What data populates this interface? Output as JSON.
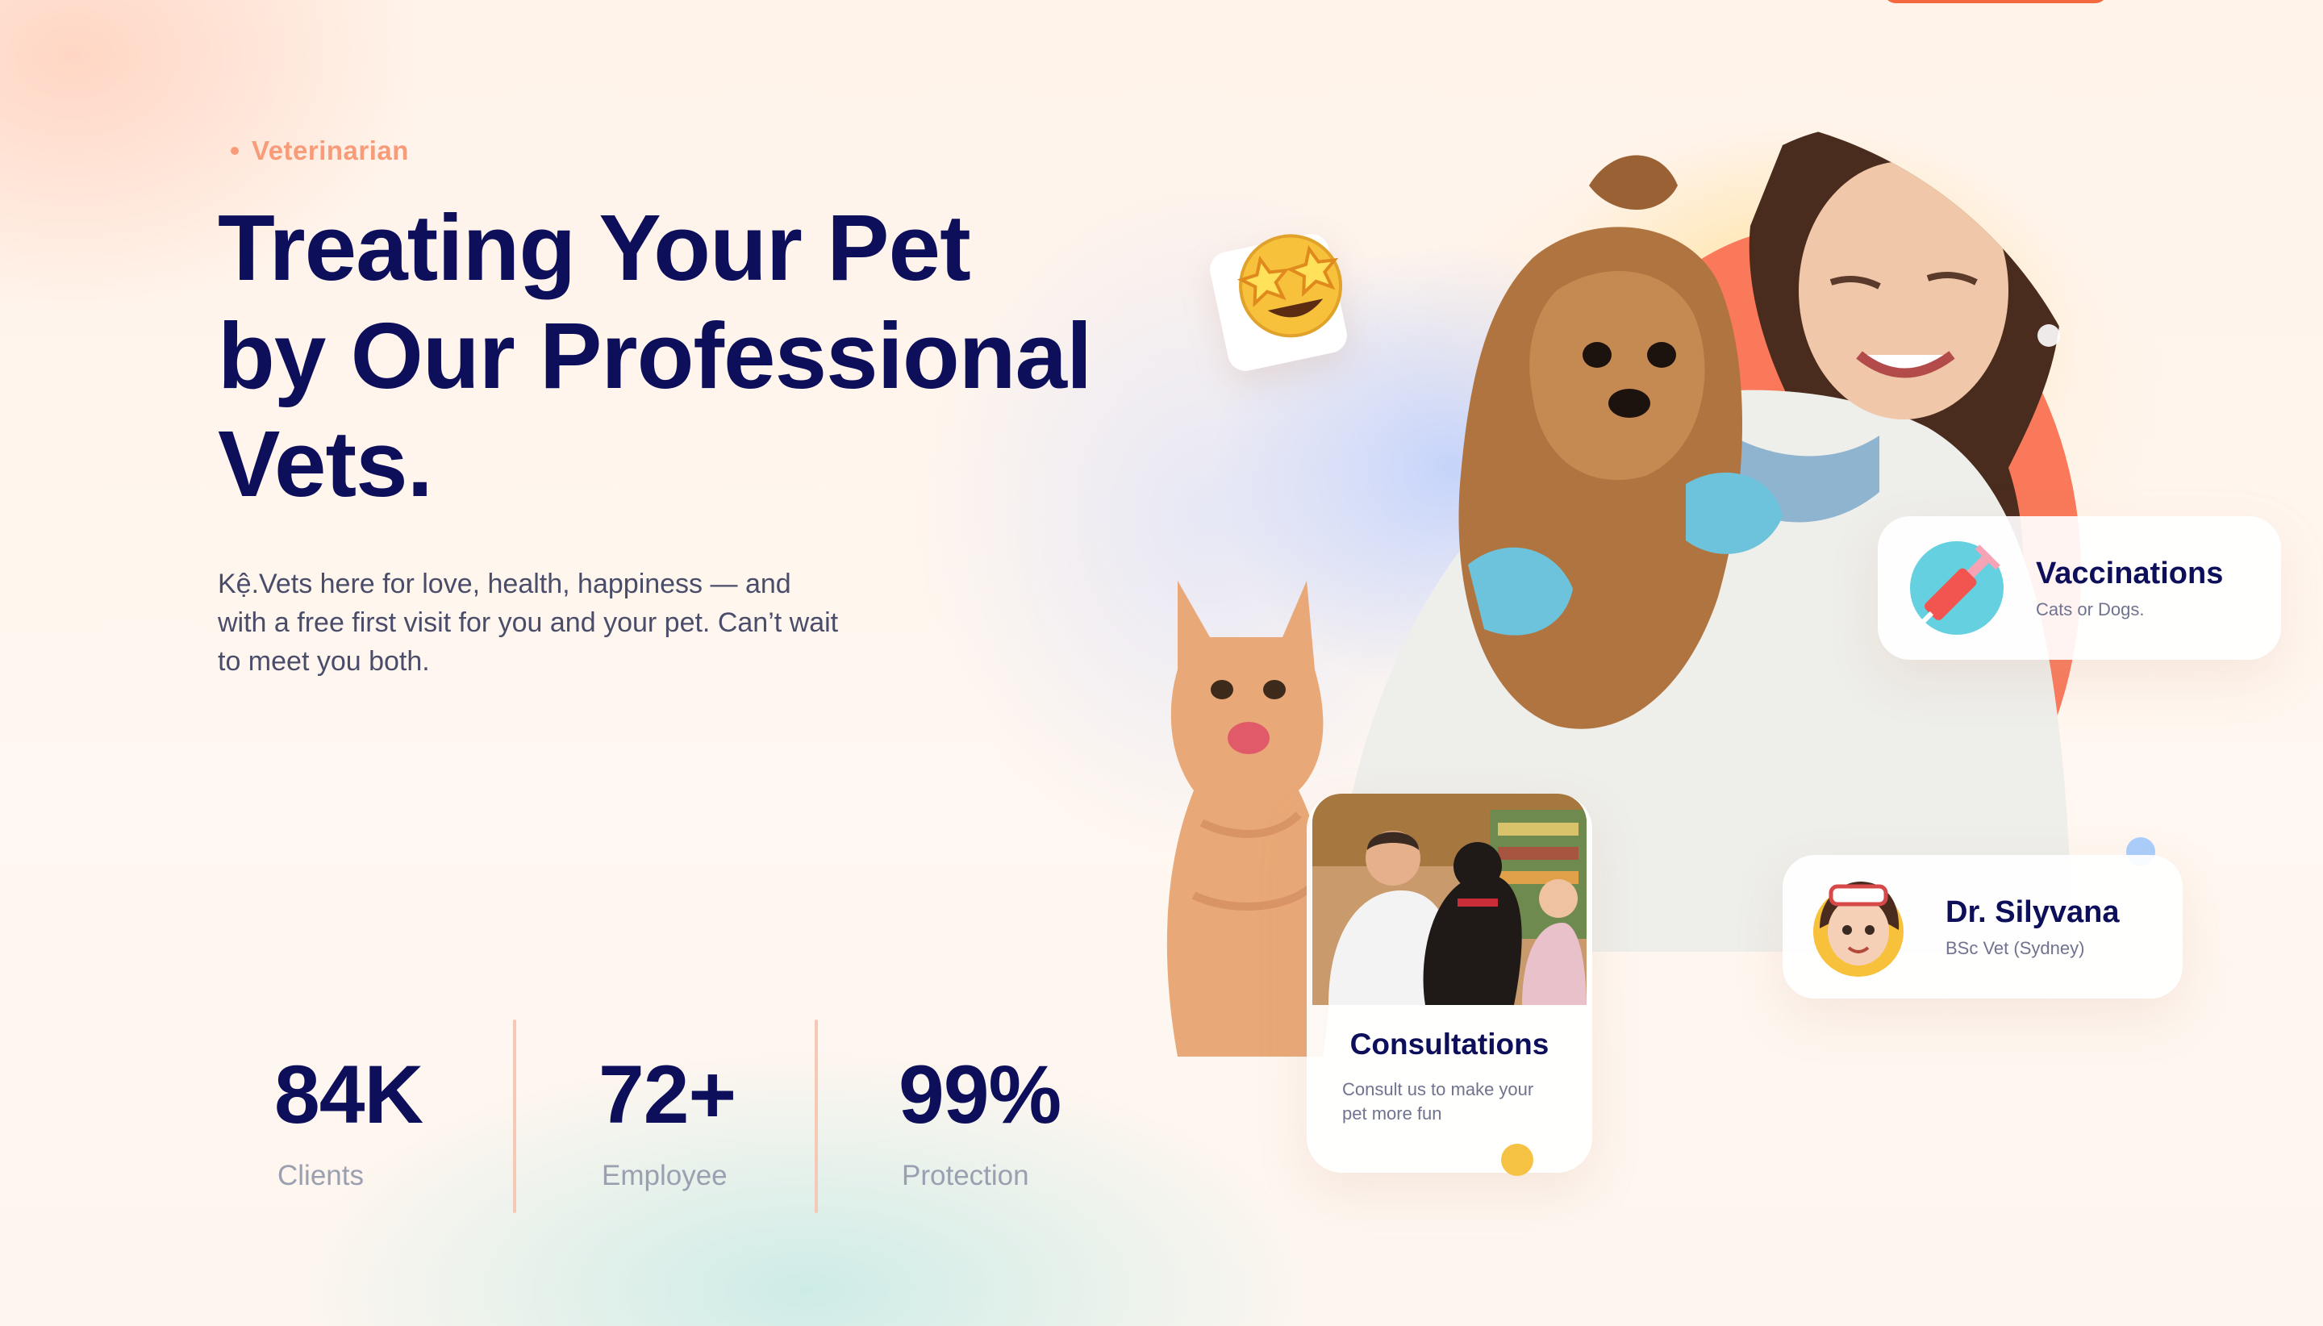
{
  "hero": {
    "eyebrow": "Veterinarian",
    "headline_lines": [
      "Treating Your Pet",
      "by Our Professional",
      "Vets."
    ],
    "lede": "Kệ.Vets here for love, health, happiness — and with a free first visit for you and your pet. Can’t wait to meet you both."
  },
  "stats": [
    {
      "value": "84K",
      "label": "Clients"
    },
    {
      "value": "72+",
      "label": "Employee"
    },
    {
      "value": "99%",
      "label": "Protection"
    }
  ],
  "cards": {
    "vaccinations": {
      "title": "Vaccinations",
      "subtitle": "Cats or Dogs.",
      "icon": "syringe-icon"
    },
    "doctor": {
      "name": "Dr. Silyvana",
      "credential": "BSc Vet (Sydney)",
      "icon": "doctor-avatar"
    },
    "consultations": {
      "title": "Consultations",
      "subtitle": "Consult us to make your pet more fun"
    }
  },
  "colors": {
    "navy": "#0d0f5b",
    "accent": "#f5683f",
    "eyebrow": "#f79b78",
    "muted": "#9aa0b0"
  },
  "decor": {
    "emoji": "star-struck-emoji"
  }
}
